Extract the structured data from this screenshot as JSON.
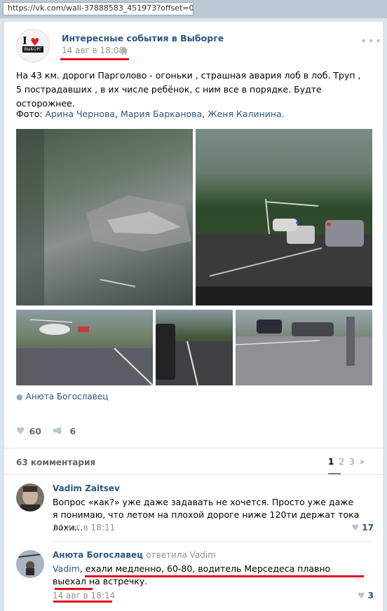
{
  "browser": {
    "url": "https://vk.com/wall-37888583_451973?offset=0"
  },
  "post": {
    "group_avatar": {
      "i": "I",
      "label": "ВЫБОРГ"
    },
    "group_name": "Интересные события в Выборге",
    "date": "14 авг в 18:08",
    "more": "•••",
    "text": "На 43 км. дороги Парголово - огоньки , страшная авария лоб в лоб. Труп , 5 пострадавших , в их числе ребёнок, с ним все в порядке. Будте осторожнее.",
    "photo_prefix": "Фото:",
    "photo_authors": [
      "Арина Чернова",
      "Мария Барканова",
      "Женя Калинина."
    ],
    "author": "Анюта Богославец",
    "likes": "60",
    "reposts": "6",
    "colors": {
      "link": "#2a5885",
      "highlight": "#e0101e"
    }
  },
  "comments_header": {
    "count_label": "63 комментария",
    "pages": [
      "1",
      "2",
      "3",
      "»"
    ]
  },
  "comments": [
    {
      "author": "Vadim Zaitsev",
      "text": "Вопрос «как?» уже даже задавать не хочется. Просто уже даже я понимаю, что летом на плохой дороге ниже 120ти держат тока лохи...",
      "date": "14 авг в 18:11",
      "likes": "17"
    },
    {
      "author": "Анюта Богославец",
      "reply_to": "ответила Vadim",
      "mention": "Vadim",
      "text": ", ехали медленно, 60-80, водитель Мерседеса плавно выехал на встречку.",
      "date": "14 авг в 18:14",
      "likes": "3"
    }
  ]
}
